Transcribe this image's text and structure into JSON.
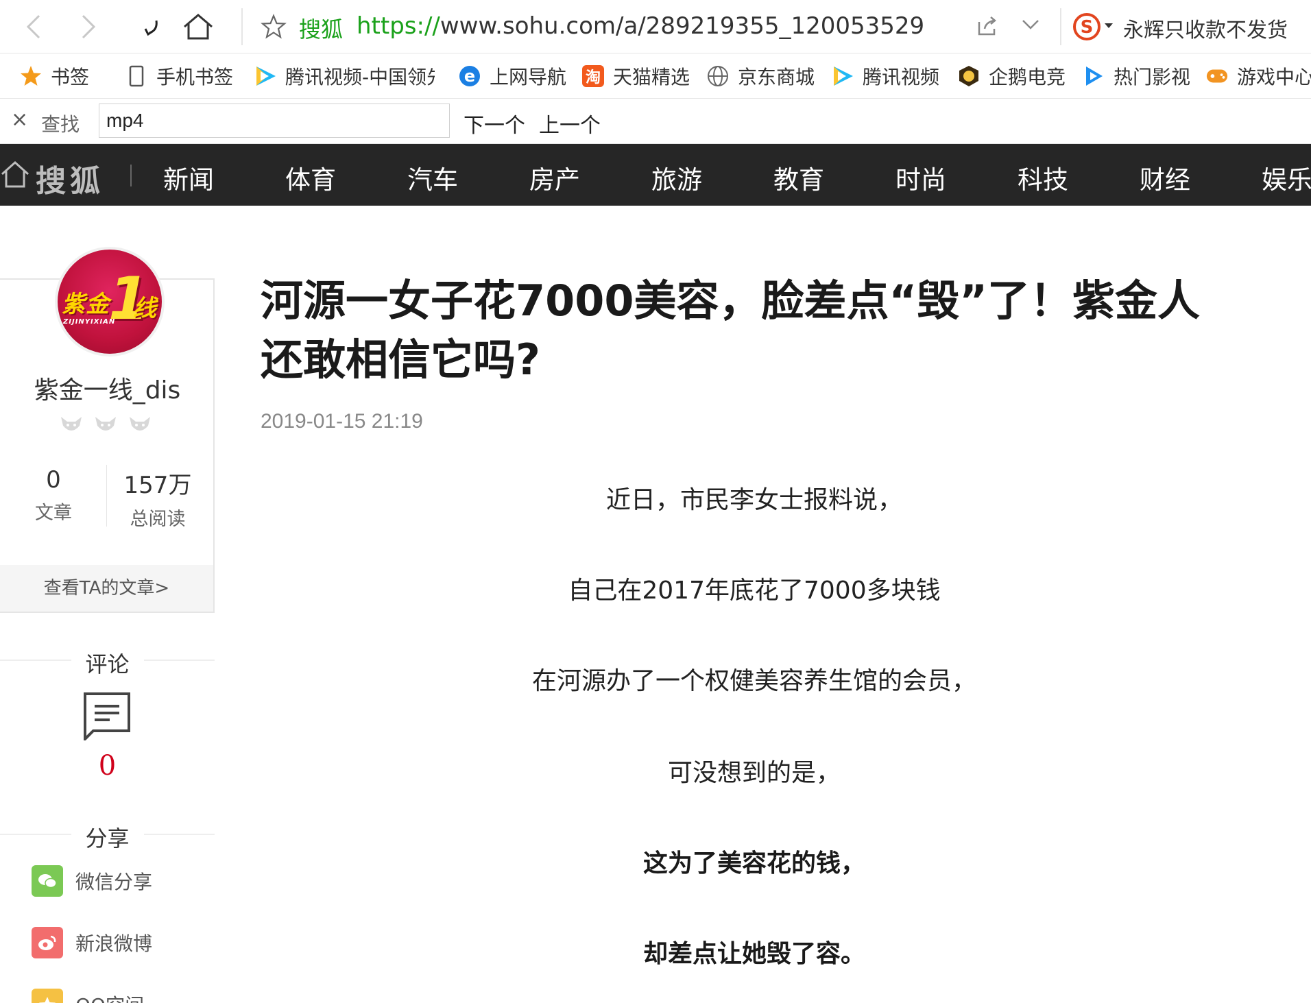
{
  "browser": {
    "site_name": "搜狐",
    "url_scheme": "https://",
    "url_rest": "www.sohu.com/a/289219355_120053529",
    "ad_text": "永辉只收款不发货"
  },
  "bookmarks": [
    {
      "label": "书签",
      "icon": "star-icon"
    },
    {
      "label": "手机书签",
      "icon": "phone-icon"
    },
    {
      "label": "腾讯视频-中国领先",
      "icon": "tencent-video-icon"
    },
    {
      "label": "上网导航",
      "icon": "ie-icon"
    },
    {
      "label": "天猫精选",
      "icon": "taobao-icon"
    },
    {
      "label": "京东商城",
      "icon": "globe-icon"
    },
    {
      "label": "腾讯视频",
      "icon": "tencent-video-icon"
    },
    {
      "label": "企鹅电竞",
      "icon": "penguin-esports-icon"
    },
    {
      "label": "热门影视",
      "icon": "play-icon"
    },
    {
      "label": "游戏中心",
      "icon": "gamepad-icon"
    }
  ],
  "findbar": {
    "close": "×",
    "label": "查找",
    "query": "mp4",
    "next": "下一个",
    "prev": "上一个"
  },
  "sohu_nav": {
    "logo": "搜狐",
    "items": [
      "新闻",
      "体育",
      "汽车",
      "房产",
      "旅游",
      "教育",
      "时尚",
      "科技",
      "财经",
      "娱乐"
    ]
  },
  "author": {
    "avatar_text_1": "紫金",
    "avatar_text_2": "1",
    "avatar_text_3": "线",
    "avatar_sub": "ZIJINYIXIAN",
    "name": "紫金一线_dis",
    "articles_count": "0",
    "articles_label": "文章",
    "reads_count": "157万",
    "reads_label": "总阅读",
    "link": "查看TA的文章>"
  },
  "comments": {
    "title": "评论",
    "count": "0"
  },
  "share": {
    "title": "分享",
    "items": [
      {
        "label": "微信分享",
        "color": "#7bc954"
      },
      {
        "label": "新浪微博",
        "color": "#f26d6d"
      },
      {
        "label": "QQ空间",
        "color": "#f5c143"
      }
    ]
  },
  "article": {
    "title": "河源一女子花7000美容，脸差点“毁”了！紫金人还敢相信它吗?",
    "date": "2019-01-15 21:19",
    "paragraphs": [
      {
        "text": "近日，市民李女士报料说，",
        "bold": false
      },
      {
        "text": "自己在2017年底花了7000多块钱",
        "bold": false
      },
      {
        "text": "在河源办了一个权健美容养生馆的会员，",
        "bold": false
      },
      {
        "text": "可没想到的是，",
        "bold": false
      },
      {
        "text": "这为了美容花的钱，",
        "bold": true
      },
      {
        "text": "却差点让她毁了容。",
        "bold": true
      }
    ]
  },
  "colors": {
    "nav_bg": "#262626",
    "site_green": "#1aa11a",
    "comment_red": "#d0021b"
  }
}
